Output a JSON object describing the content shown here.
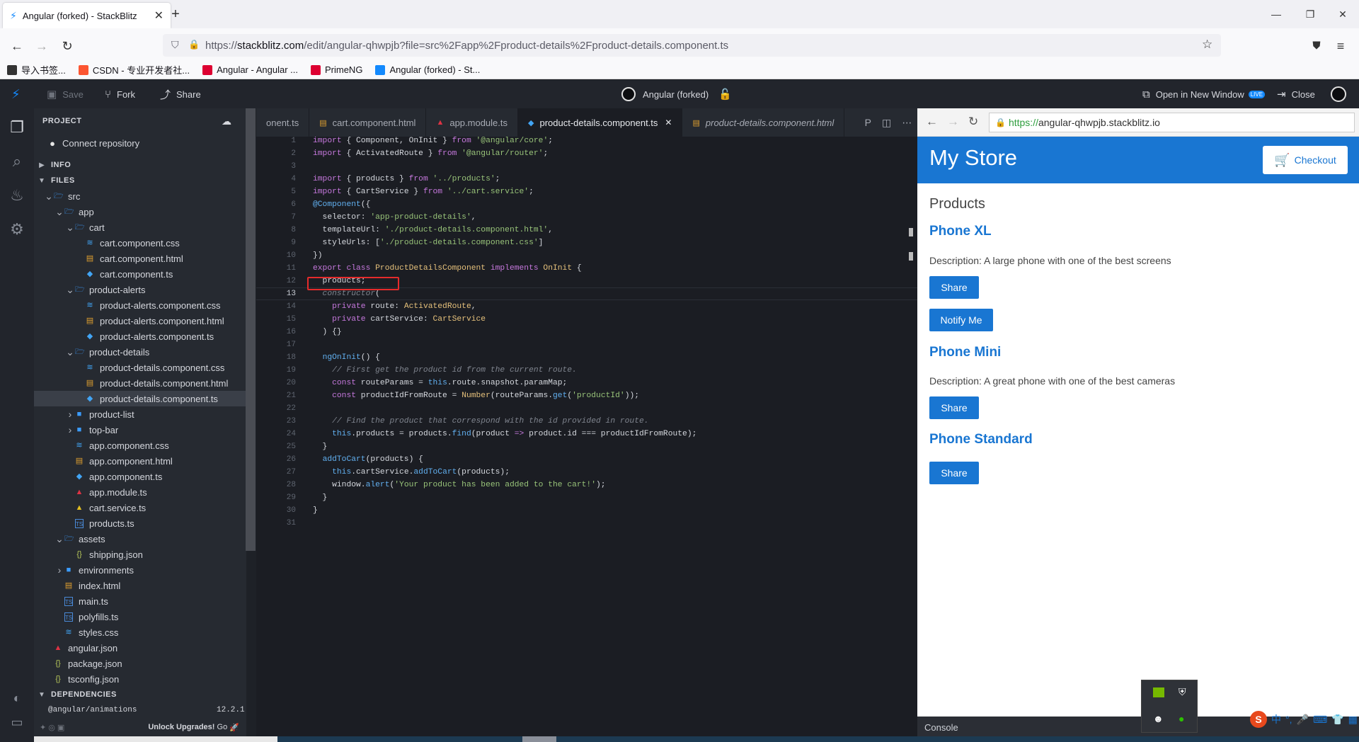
{
  "browser": {
    "tab_title": "Angular (forked) - StackBlitz",
    "url_prefix": "https://",
    "url_host": "stackblitz.com",
    "url_path": "/edit/angular-qhwpjb?file=src%2Fapp%2Fproduct-details%2Fproduct-details.component.ts",
    "bookmarks": [
      {
        "label": "导入书签...",
        "color": "#333"
      },
      {
        "label": "CSDN - 专业开发者社...",
        "color": "#fc5531"
      },
      {
        "label": "Angular - Angular ...",
        "color": "#dd0031"
      },
      {
        "label": "PrimeNG",
        "color": "#dd0031"
      },
      {
        "label": "Angular (forked) - St...",
        "color": "#1389fd"
      }
    ]
  },
  "stackblitz": {
    "save": "Save",
    "fork": "Fork",
    "share": "Share",
    "project_name": "Angular (forked)",
    "open_new_window": "Open in New Window",
    "live_badge": "LIVE",
    "close": "Close"
  },
  "sidebar": {
    "project_label": "PROJECT",
    "connect_repo": "Connect repository",
    "info": "INFO",
    "files": "FILES",
    "dependencies": "DEPENDENCIES",
    "dep_name": "@angular/animations",
    "dep_version": "12.2.1",
    "unlock": "Unlock Upgrades!",
    "go": "Go",
    "tree": [
      {
        "label": "src",
        "depth": 0,
        "kind": "folder-open"
      },
      {
        "label": "app",
        "depth": 1,
        "kind": "folder-open"
      },
      {
        "label": "cart",
        "depth": 2,
        "kind": "folder-open"
      },
      {
        "label": "cart.component.css",
        "depth": 3,
        "kind": "css"
      },
      {
        "label": "cart.component.html",
        "depth": 3,
        "kind": "html"
      },
      {
        "label": "cart.component.ts",
        "depth": 3,
        "kind": "ngts"
      },
      {
        "label": "product-alerts",
        "depth": 2,
        "kind": "folder-open"
      },
      {
        "label": "product-alerts.component.css",
        "depth": 3,
        "kind": "css"
      },
      {
        "label": "product-alerts.component.html",
        "depth": 3,
        "kind": "html"
      },
      {
        "label": "product-alerts.component.ts",
        "depth": 3,
        "kind": "ngts"
      },
      {
        "label": "product-details",
        "depth": 2,
        "kind": "folder-open"
      },
      {
        "label": "product-details.component.css",
        "depth": 3,
        "kind": "css"
      },
      {
        "label": "product-details.component.html",
        "depth": 3,
        "kind": "html"
      },
      {
        "label": "product-details.component.ts",
        "depth": 3,
        "kind": "ngts",
        "selected": true
      },
      {
        "label": "product-list",
        "depth": 2,
        "kind": "folder"
      },
      {
        "label": "top-bar",
        "depth": 2,
        "kind": "folder"
      },
      {
        "label": "app.component.css",
        "depth": 2,
        "kind": "css"
      },
      {
        "label": "app.component.html",
        "depth": 2,
        "kind": "html"
      },
      {
        "label": "app.component.ts",
        "depth": 2,
        "kind": "ngts"
      },
      {
        "label": "app.module.ts",
        "depth": 2,
        "kind": "ngmod"
      },
      {
        "label": "cart.service.ts",
        "depth": 2,
        "kind": "service"
      },
      {
        "label": "products.ts",
        "depth": 2,
        "kind": "ts"
      },
      {
        "label": "assets",
        "depth": 1,
        "kind": "folder-open"
      },
      {
        "label": "shipping.json",
        "depth": 2,
        "kind": "json"
      },
      {
        "label": "environments",
        "depth": 1,
        "kind": "folder"
      },
      {
        "label": "index.html",
        "depth": 1,
        "kind": "html"
      },
      {
        "label": "main.ts",
        "depth": 1,
        "kind": "ts"
      },
      {
        "label": "polyfills.ts",
        "depth": 1,
        "kind": "ts"
      },
      {
        "label": "styles.css",
        "depth": 1,
        "kind": "css"
      },
      {
        "label": "angular.json",
        "depth": 0,
        "kind": "ngmod"
      },
      {
        "label": "package.json",
        "depth": 0,
        "kind": "json"
      },
      {
        "label": "tsconfig.json",
        "depth": 0,
        "kind": "json"
      }
    ]
  },
  "editor": {
    "tabs": [
      {
        "label": "onent.ts",
        "icon": "",
        "active": false,
        "italic": false
      },
      {
        "label": "cart.component.html",
        "icon": "html",
        "active": false,
        "italic": false
      },
      {
        "label": "app.module.ts",
        "icon": "ngmod",
        "active": false,
        "italic": false
      },
      {
        "label": "product-details.component.ts",
        "icon": "ngts",
        "active": true,
        "italic": false
      },
      {
        "label": "product-details.component.html",
        "icon": "html",
        "active": false,
        "italic": true
      }
    ],
    "lines": [
      [
        [
          "kw",
          "import"
        ],
        [
          "pl",
          " { Component, OnInit } "
        ],
        [
          "kw",
          "from"
        ],
        [
          "st",
          " '@angular/core'"
        ],
        [
          "pl",
          ";"
        ]
      ],
      [
        [
          "kw",
          "import"
        ],
        [
          "pl",
          " { ActivatedRoute } "
        ],
        [
          "kw",
          "from"
        ],
        [
          "st",
          " '@angular/router'"
        ],
        [
          "pl",
          ";"
        ]
      ],
      [],
      [
        [
          "kw",
          "import"
        ],
        [
          "pl",
          " { products } "
        ],
        [
          "kw",
          "from"
        ],
        [
          "st",
          " '../products'"
        ],
        [
          "pl",
          ";"
        ]
      ],
      [
        [
          "kw",
          "import"
        ],
        [
          "pl",
          " { CartService } "
        ],
        [
          "kw",
          "from"
        ],
        [
          "st",
          " '../cart.service'"
        ],
        [
          "pl",
          ";"
        ]
      ],
      [
        [
          "fn",
          "@Component"
        ],
        [
          "pl",
          "({"
        ]
      ],
      [
        [
          "pl",
          "  selector: "
        ],
        [
          "st",
          "'app-product-details'"
        ],
        [
          "pl",
          ","
        ]
      ],
      [
        [
          "pl",
          "  templateUrl: "
        ],
        [
          "st",
          "'./product-details.component.html'"
        ],
        [
          "pl",
          ","
        ]
      ],
      [
        [
          "pl",
          "  styleUrls: ["
        ],
        [
          "st",
          "'./product-details.component.css'"
        ],
        [
          "pl",
          "]"
        ]
      ],
      [
        [
          "pl",
          "})"
        ]
      ],
      [
        [
          "kw",
          "export class "
        ],
        [
          "ty",
          "ProductDetailsComponent "
        ],
        [
          "kw",
          "implements "
        ],
        [
          "ty",
          "OnInit"
        ],
        [
          "pl",
          " {"
        ]
      ],
      [
        [
          "pl",
          "  products;"
        ]
      ],
      [
        [
          "cm",
          "  constructor"
        ],
        [
          "pl",
          "("
        ]
      ],
      [
        [
          "pl",
          "    "
        ],
        [
          "kw",
          "private"
        ],
        [
          "pl",
          " route: "
        ],
        [
          "ty",
          "ActivatedRoute"
        ],
        [
          "pl",
          ","
        ]
      ],
      [
        [
          "pl",
          "    "
        ],
        [
          "kw",
          "private"
        ],
        [
          "pl",
          " cartService: "
        ],
        [
          "ty",
          "CartService"
        ]
      ],
      [
        [
          "pl",
          "  ) {}"
        ]
      ],
      [],
      [
        [
          "pl",
          "  "
        ],
        [
          "fn",
          "ngOnInit"
        ],
        [
          "pl",
          "() {"
        ]
      ],
      [
        [
          "cm",
          "    // First get the product id from the current route."
        ]
      ],
      [
        [
          "pl",
          "    "
        ],
        [
          "kw",
          "const"
        ],
        [
          "pl",
          " routeParams = "
        ],
        [
          "th",
          "this"
        ],
        [
          "pl",
          ".route.snapshot.paramMap;"
        ]
      ],
      [
        [
          "pl",
          "    "
        ],
        [
          "kw",
          "const"
        ],
        [
          "pl",
          " productIdFromRoute = "
        ],
        [
          "ty",
          "Number"
        ],
        [
          "pl",
          "(routeParams."
        ],
        [
          "fn",
          "get"
        ],
        [
          "pl",
          "("
        ],
        [
          "st",
          "'productId'"
        ],
        [
          "pl",
          "));"
        ]
      ],
      [],
      [
        [
          "cm",
          "    // Find the product that correspond with the id provided in route."
        ]
      ],
      [
        [
          "pl",
          "    "
        ],
        [
          "th",
          "this"
        ],
        [
          "pl",
          ".products = products."
        ],
        [
          "fn",
          "find"
        ],
        [
          "pl",
          "(product "
        ],
        [
          "kw",
          "=>"
        ],
        [
          "pl",
          " product.id === productIdFromRoute);"
        ]
      ],
      [
        [
          "pl",
          "  }"
        ]
      ],
      [
        [
          "pl",
          "  "
        ],
        [
          "fn",
          "addToCart"
        ],
        [
          "pl",
          "(products) {"
        ]
      ],
      [
        [
          "pl",
          "    "
        ],
        [
          "th",
          "this"
        ],
        [
          "pl",
          ".cartService."
        ],
        [
          "fn",
          "addToCart"
        ],
        [
          "pl",
          "(products);"
        ]
      ],
      [
        [
          "pl",
          "    window."
        ],
        [
          "fn",
          "alert"
        ],
        [
          "pl",
          "("
        ],
        [
          "st",
          "'Your product has been added to the cart!'"
        ],
        [
          "pl",
          ");"
        ]
      ],
      [
        [
          "pl",
          "  }"
        ]
      ],
      [
        [
          "pl",
          "}"
        ]
      ],
      []
    ]
  },
  "preview": {
    "url_scheme": "https://",
    "url_host": "angular-qhwpjb.stackblitz.io",
    "store_title": "My Store",
    "checkout": "Checkout",
    "products_heading": "Products",
    "products": [
      {
        "name": "Phone XL",
        "description": "Description: A large phone with one of the best screens",
        "buttons": [
          "Share",
          "Notify Me"
        ]
      },
      {
        "name": "Phone Mini",
        "description": "Description: A great phone with one of the best cameras",
        "buttons": [
          "Share"
        ]
      },
      {
        "name": "Phone Standard",
        "description": "",
        "buttons": [
          "Share"
        ]
      }
    ],
    "console": "Console"
  },
  "ime": {
    "label": "中"
  }
}
